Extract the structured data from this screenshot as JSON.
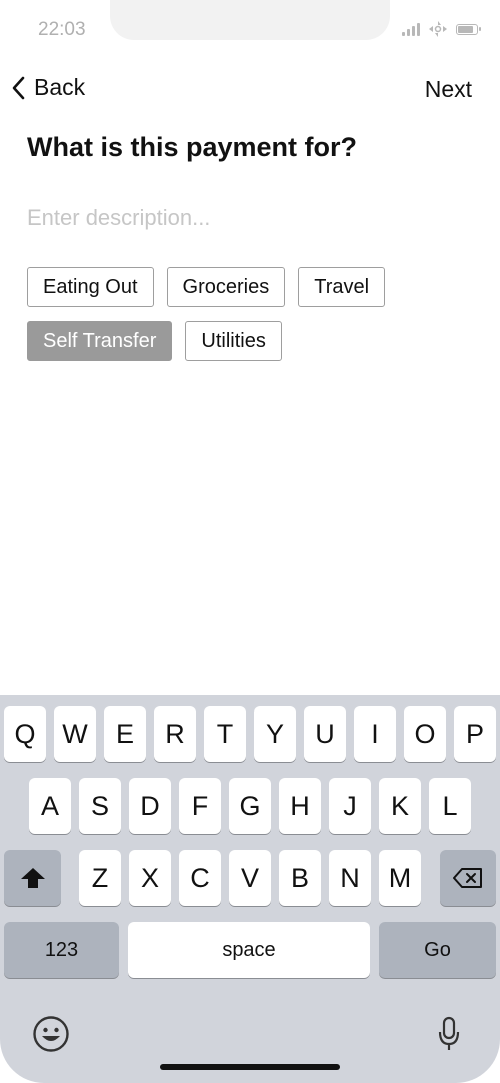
{
  "status_bar": {
    "time": "22:03"
  },
  "nav": {
    "back_label": "Back",
    "next_label": "Next"
  },
  "question": "What is this payment for?",
  "description_input": {
    "value": "",
    "placeholder": "Enter description..."
  },
  "categories": [
    {
      "label": "Eating Out",
      "selected": false
    },
    {
      "label": "Groceries",
      "selected": false
    },
    {
      "label": "Travel",
      "selected": false
    },
    {
      "label": "Self Transfer",
      "selected": true
    },
    {
      "label": "Utilities",
      "selected": false
    }
  ],
  "keyboard": {
    "row1": [
      "Q",
      "W",
      "E",
      "R",
      "T",
      "Y",
      "U",
      "I",
      "O",
      "P"
    ],
    "row2": [
      "A",
      "S",
      "D",
      "F",
      "G",
      "H",
      "J",
      "K",
      "L"
    ],
    "row3": [
      "Z",
      "X",
      "C",
      "V",
      "B",
      "N",
      "M"
    ],
    "numbers_label": "123",
    "space_label": "space",
    "go_label": "Go"
  },
  "colors": {
    "selected_chip": "#9a9a9a",
    "keyboard_bg": "#d1d4db",
    "special_key": "#adb3bd",
    "placeholder": "#c6c6c6"
  }
}
